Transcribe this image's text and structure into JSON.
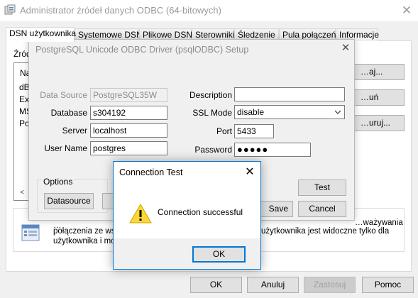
{
  "main": {
    "title": "Administrator źródeł danych ODBC (64-bitowych)",
    "tabs": [
      "DSN użytkownika",
      "Systemowe DSN",
      "Plikowe DSN",
      "Sterowniki",
      "Śledzenie",
      "Pula połączeń",
      "Informacje"
    ],
    "sources_label_fragment": "Źród",
    "list_header_fragment": "Na",
    "list_items": [
      "dB",
      "Ex",
      "MS",
      "Po"
    ],
    "right_buttons": [
      "…aj...",
      "…uń",
      "…uruj..."
    ],
    "info_text_line1_left": "…",
    "info_text_line1_right": "…ważywania",
    "info_text_line2_left": "połączenia ze wsk",
    "info_text_line2_right": "użytkownika jest widoczne tylko dla",
    "info_text_line3_left": "użytkownika i moż",
    "bottom_buttons": {
      "ok": "OK",
      "cancel": "Anuluj",
      "apply": "Zastosuj",
      "help": "Pomoc"
    }
  },
  "setup": {
    "title": "PostgreSQL Unicode ODBC Driver (psqlODBC) Setup",
    "fields": {
      "data_source_label": "Data Source",
      "data_source_value": "PostgreSQL35W",
      "database_label": "Database",
      "database_value": "s304192",
      "server_label": "Server",
      "server_value": "localhost",
      "username_label": "User Name",
      "username_value": "postgres",
      "description_label": "Description",
      "description_value": "",
      "ssl_label": "SSL Mode",
      "ssl_value": "disable",
      "port_label": "Port",
      "port_value": "5433",
      "password_label": "Password",
      "password_value": "●●●●●"
    },
    "options_label": "Options",
    "datasource_button": "Datasource",
    "test_button": "Test",
    "save_button_fragment": "Save",
    "cancel_button": "Cancel"
  },
  "connection_test": {
    "title": "Connection Test",
    "message": "Connection successful",
    "ok_button": "OK"
  },
  "colors": {
    "accent": "#0078d7",
    "warning": "#fdd835"
  }
}
